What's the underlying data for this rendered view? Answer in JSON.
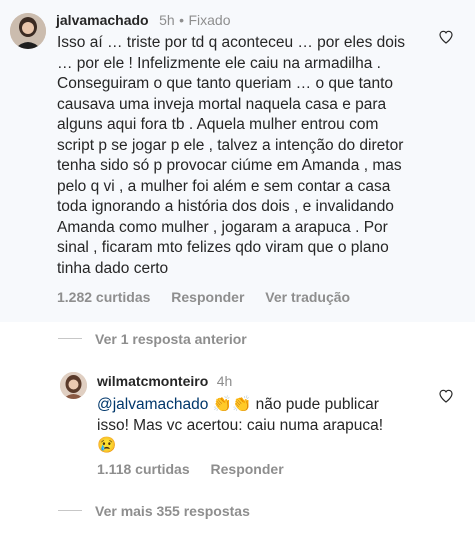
{
  "comment": {
    "username": "jalvamachado",
    "time": "5h",
    "separator": "•",
    "pinned_label": "Fixado",
    "text": "Isso aí … triste por td q aconteceu … por eles dois … por ele ! Infelizmente ele caiu na armadilha . Conseguiram o que tanto queriam … o que tanto causava uma inveja mortal naquela casa e para alguns aqui fora tb . Aquela mulher entrou com script p se jogar p ele , talvez a intenção do diretor tenha sido só p provocar ciúme em Amanda , mas pelo q vi , a mulher foi além e sem contar a casa toda ignorando a história dos dois , e invalidando Amanda como mulher , jogaram a arapuca . Por sinal , ficaram mto felizes qdo viram que o plano tinha dado certo",
    "likes": "1.282 curtidas",
    "reply_label": "Responder",
    "translate_label": "Ver tradução"
  },
  "view_previous": "Ver 1 resposta anterior",
  "reply": {
    "username": "wilmatcmonteiro",
    "time": "4h",
    "mention": "@jalvamachado",
    "emoji1": "👏👏",
    "text1": "não pude publicar",
    "text2": "isso! Mas vc acertou: caiu numa arapuca!",
    "emoji2": "😢",
    "likes": "1.118 curtidas",
    "reply_label": "Responder"
  },
  "view_more": "Ver mais 355 respostas",
  "icons": {
    "like": "heart-outline-icon"
  },
  "colors": {
    "pinned_bg": "#f7f9fc",
    "muted": "#8e8e8e",
    "text": "#262626",
    "mention": "#00376b"
  }
}
